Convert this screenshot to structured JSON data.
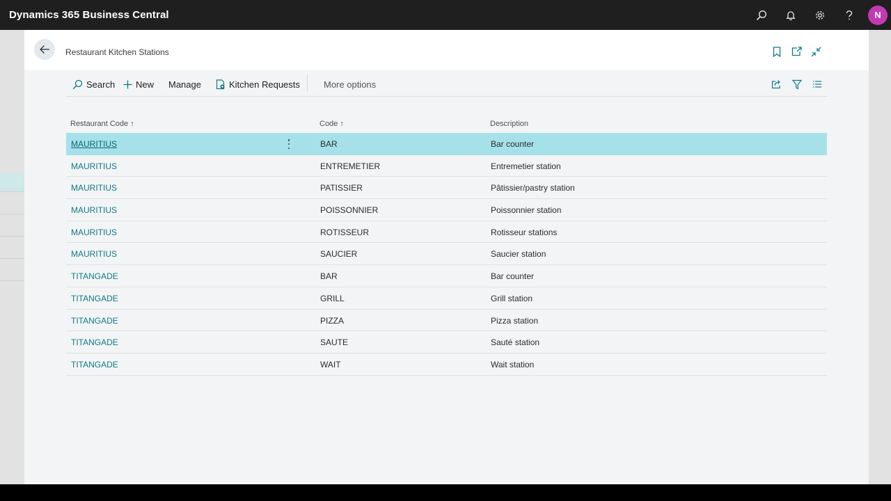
{
  "app": {
    "title": "Dynamics 365 Business Central",
    "user_initial": "N"
  },
  "page": {
    "title": "Restaurant Kitchen Stations"
  },
  "actions": {
    "search": "Search",
    "new": "New",
    "manage": "Manage",
    "kitchen_requests": "Kitchen Requests",
    "more_options": "More options"
  },
  "table": {
    "columns": [
      "Restaurant Code ↑",
      "Code ↑",
      "Description"
    ],
    "rows": [
      {
        "restaurant": "MAURITIUS",
        "code": "BAR",
        "description": "Bar counter"
      },
      {
        "restaurant": "MAURITIUS",
        "code": "ENTREMETIER",
        "description": "Entremetier station"
      },
      {
        "restaurant": "MAURITIUS",
        "code": "PATISSIER",
        "description": "Pâtissier/pastry station"
      },
      {
        "restaurant": "MAURITIUS",
        "code": "POISSONNIER",
        "description": "Poissonnier station"
      },
      {
        "restaurant": "MAURITIUS",
        "code": "ROTISSEUR",
        "description": "Rotisseur stations"
      },
      {
        "restaurant": "MAURITIUS",
        "code": "SAUCIER",
        "description": "Saucier station"
      },
      {
        "restaurant": "TITANGADE",
        "code": "BAR",
        "description": "Bar counter"
      },
      {
        "restaurant": "TITANGADE",
        "code": "GRILL",
        "description": "Grill station"
      },
      {
        "restaurant": "TITANGADE",
        "code": "PIZZA",
        "description": "Pizza station"
      },
      {
        "restaurant": "TITANGADE",
        "code": "SAUTE",
        "description": "Sauté station"
      },
      {
        "restaurant": "TITANGADE",
        "code": "WAIT",
        "description": "Wait station"
      }
    ]
  },
  "colors": {
    "accent": "#0e7a87",
    "selected_row": "#a6e1ea",
    "topbar": "#1f1f1f",
    "avatar": "#c239b3"
  },
  "icons": [
    "search-icon",
    "bell-icon",
    "gear-icon",
    "help-icon",
    "back-arrow-icon",
    "bookmark-icon",
    "open-new-window-icon",
    "collapse-icon",
    "plus-icon",
    "kitchen-requests-icon",
    "share-icon",
    "filter-icon",
    "list-view-icon",
    "more-vertical-icon"
  ]
}
